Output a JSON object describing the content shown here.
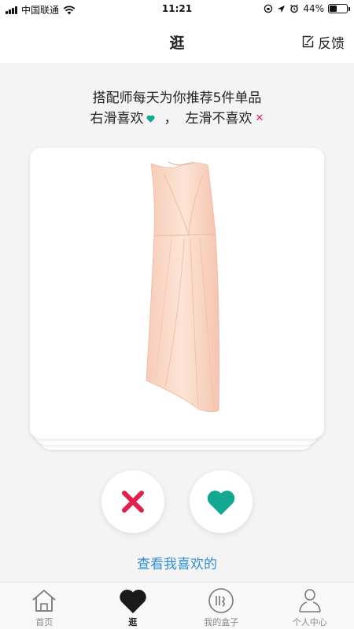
{
  "status_bar": {
    "carrier": "中国联通",
    "time": "11:21",
    "battery": "44%",
    "battery_level": 0.44
  },
  "nav": {
    "title": "逛",
    "feedback_label": "反馈"
  },
  "intro": {
    "line1": "搭配师每天为你推荐5件单品",
    "swipe_right": "右滑喜欢",
    "separator": "，",
    "swipe_left": "左滑不喜欢"
  },
  "card": {
    "image": "peach-sleeveless-asymmetric-dress"
  },
  "actions": {
    "dislike_icon": "x-icon",
    "like_icon": "heart-icon",
    "dislike_color": "#e0204e",
    "like_color": "#12a891"
  },
  "view_liked_label": "查看我喜欢的",
  "tabs": [
    {
      "label": "首页",
      "icon": "home-icon"
    },
    {
      "label": "逛",
      "icon": "heart-icon",
      "active": true
    },
    {
      "label": "我的盒子",
      "icon": "box-icon"
    },
    {
      "label": "个人中心",
      "icon": "person-icon"
    }
  ]
}
